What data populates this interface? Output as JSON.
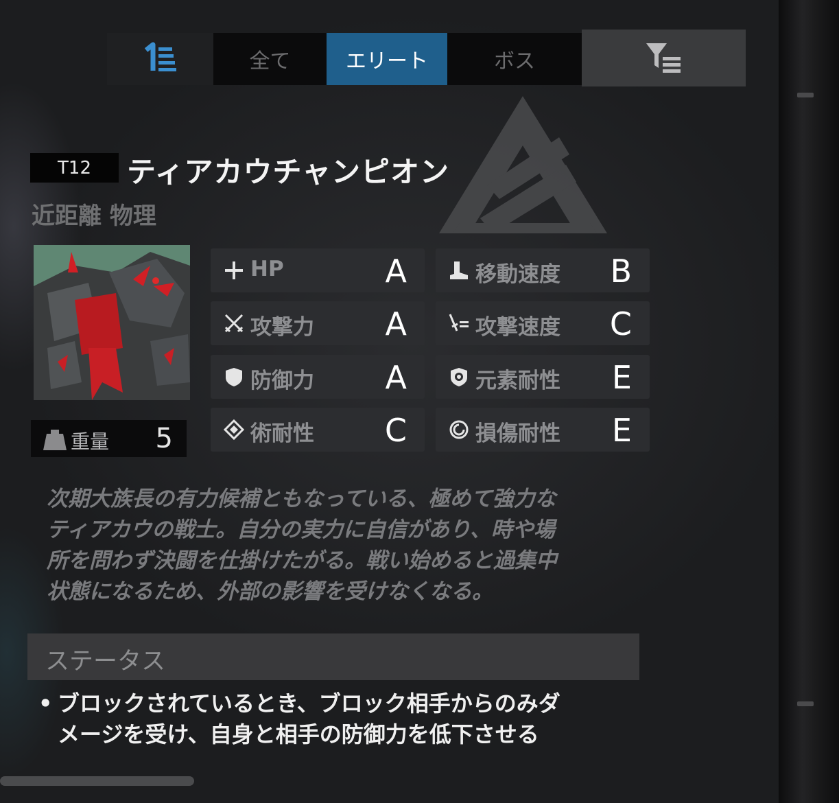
{
  "tabs": {
    "sort_icon": "sort-order-icon",
    "items": [
      {
        "label": "全て"
      },
      {
        "label": "エリート"
      },
      {
        "label": "ボス"
      }
    ],
    "active_index": 1,
    "filter_icon": "filter-icon",
    "accent_color": "#1f5f8c"
  },
  "enemy": {
    "tier": "T12",
    "name": "ティアカウチャンピオン",
    "tags": "近距離 物理",
    "weight_label": "重量",
    "weight_value": "5"
  },
  "stats": [
    {
      "icon": "plus-icon",
      "label": "HP",
      "grade": "A"
    },
    {
      "icon": "boot-icon",
      "label": "移動速度",
      "grade": "B"
    },
    {
      "icon": "crossed-swords-icon",
      "label": "攻撃力",
      "grade": "A"
    },
    {
      "icon": "sword-speed-icon",
      "label": "攻撃速度",
      "grade": "C"
    },
    {
      "icon": "shield-icon",
      "label": "防御力",
      "grade": "A"
    },
    {
      "icon": "element-shield-icon",
      "label": "元素耐性",
      "grade": "E"
    },
    {
      "icon": "diamond-icon",
      "label": "術耐性",
      "grade": "C"
    },
    {
      "icon": "swirl-icon",
      "label": "損傷耐性",
      "grade": "E"
    }
  ],
  "description": [
    "次期大族長の有力候補ともなっている、極めて強力な",
    "ティアカウの戦士。自分の実力に自信があり、時や場",
    "所を問わず決闘を仕掛けたがる。戦い始めると過集中",
    "状態になるため、外部の影響を受けなくなる。"
  ],
  "status": {
    "header": "ステータス",
    "bullet": "•",
    "lines": [
      "ブロックされているとき、ブロック相手からのみダ",
      "メージを受け、自身と相手の防御力を低下させる"
    ]
  }
}
